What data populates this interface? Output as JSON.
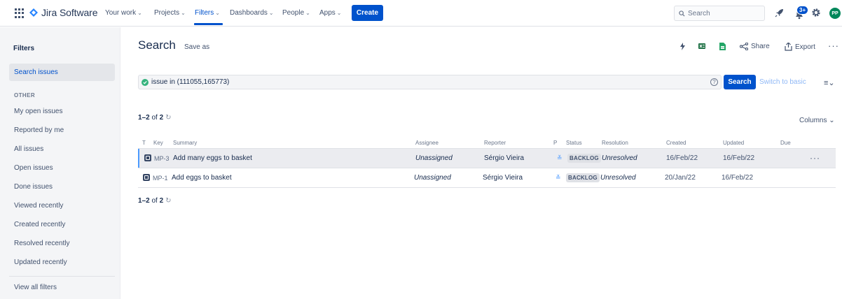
{
  "nav": {
    "logo_text": "Jira Software",
    "items": [
      {
        "label": "Your work",
        "chev": "⌄"
      },
      {
        "label": "Projects",
        "chev": "⌄"
      },
      {
        "label": "Filters",
        "chev": "⌄"
      },
      {
        "label": "Dashboards",
        "chev": "⌄"
      },
      {
        "label": "People",
        "chev": "⌄"
      },
      {
        "label": "Apps",
        "chev": "⌄"
      }
    ],
    "create_label": "Create",
    "search_placeholder": "Search",
    "notifications_badge": "3+",
    "avatar_initials": "PP"
  },
  "sidebar": {
    "title": "Filters",
    "active_item": "Search issues",
    "section_label": "OTHER",
    "items": [
      "My open issues",
      "Reported by me",
      "All issues",
      "Open issues",
      "Done issues",
      "Viewed recently",
      "Created recently",
      "Resolved recently",
      "Updated recently"
    ],
    "view_all": "View all filters"
  },
  "main": {
    "title": "Search",
    "save_as": "Save as",
    "share_label": "Share",
    "export_label": "Export",
    "jql_query": "issue in (111055,165773)",
    "search_button": "Search",
    "switch_basic": "Switch to basic",
    "count_range": "1–2",
    "count_of": "of",
    "count_total": "2",
    "columns_label": "Columns ⌄"
  },
  "table": {
    "headers": {
      "type": "T",
      "key": "Key",
      "summary": "Summary",
      "assignee": "Assignee",
      "reporter": "Reporter",
      "priority": "P",
      "status": "Status",
      "resolution": "Resolution",
      "created": "Created",
      "updated": "Updated",
      "due": "Due"
    },
    "rows": [
      {
        "key": "MP-3",
        "summary": "Add many eggs to basket",
        "assignee": "Unassigned",
        "reporter": "Sérgio Vieira",
        "status": "BACKLOG",
        "resolution": "Unresolved",
        "created": "16/Feb/22",
        "updated": "16/Feb/22",
        "due": ""
      },
      {
        "key": "MP-1",
        "summary": "Add eggs to basket",
        "assignee": "Unassigned",
        "reporter": "Sérgio Vieira",
        "status": "BACKLOG",
        "resolution": "Unresolved",
        "created": "20/Jan/22",
        "updated": "16/Feb/22",
        "due": ""
      }
    ]
  },
  "colors": {
    "brand": "#0052cc",
    "sidebar_bg": "#f4f5f7",
    "selected_row": "#ebecf0",
    "success": "#36b37e"
  }
}
